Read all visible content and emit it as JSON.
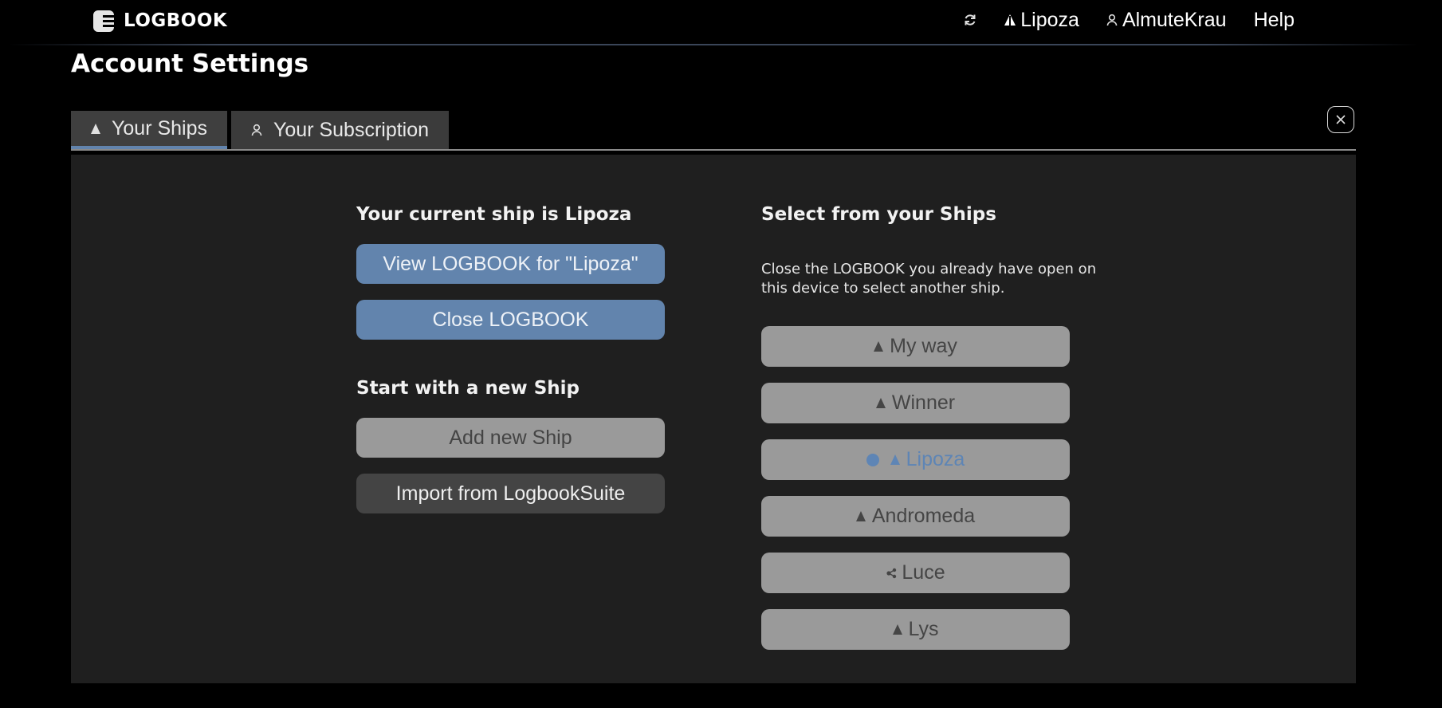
{
  "header": {
    "brand": "LOGBOOK",
    "current_ship": "Lipoza",
    "user": "AlmuteKrau",
    "help": "Help"
  },
  "page_title": "Account Settings",
  "tabs": [
    {
      "label": "Your Ships",
      "active": true
    },
    {
      "label": "Your Subscription",
      "active": false
    }
  ],
  "left": {
    "current_heading": "Your current ship is Lipoza",
    "view_button": "View LOGBOOK for \"Lipoza\"",
    "close_button": "Close LOGBOOK",
    "new_heading": "Start with a new Ship",
    "add_button": "Add new Ship",
    "import_button": "Import from LogbookSuite"
  },
  "right": {
    "heading": "Select from your Ships",
    "help_line1": "Close the LOGBOOK you already have open on",
    "help_line2": "this device to select another ship.",
    "ships": [
      {
        "name": "My way",
        "icon": "sail-icon"
      },
      {
        "name": "Winner",
        "icon": "sail-icon"
      },
      {
        "name": "Lipoza",
        "icon": "sail-icon",
        "current": true
      },
      {
        "name": "Andromeda",
        "icon": "sail-icon"
      },
      {
        "name": "Luce",
        "icon": "network-icon"
      },
      {
        "name": "Lys",
        "icon": "sail-icon"
      }
    ]
  },
  "colors": {
    "accent": "#6284ad",
    "panel": "#1f1f1f",
    "background": "#000000"
  }
}
